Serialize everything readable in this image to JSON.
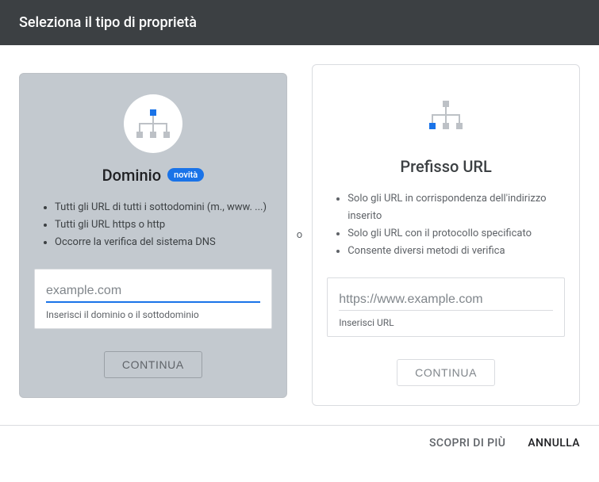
{
  "header": {
    "title": "Seleziona il tipo di proprietà"
  },
  "separator_label": "o",
  "domain_card": {
    "title": "Dominio",
    "badge": "novità",
    "bullets": [
      "Tutti gli URL di tutti i sottodomini (m., www. ...)",
      "Tutti gli URL https o http",
      "Occorre la verifica del sistema DNS"
    ],
    "placeholder": "example.com",
    "helper": "Inserisci il dominio o il sottodominio",
    "button": "CONTINUA"
  },
  "url_card": {
    "title": "Prefisso URL",
    "bullets": [
      "Solo gli URL in corrispondenza dell'indirizzo inserito",
      "Solo gli URL con il protocollo specificato",
      "Consente diversi metodi di verifica"
    ],
    "placeholder": "https://www.example.com",
    "helper": "Inserisci URL",
    "button": "CONTINUA"
  },
  "footer": {
    "learn_more": "SCOPRI DI PIÙ",
    "cancel": "ANNULLA"
  }
}
